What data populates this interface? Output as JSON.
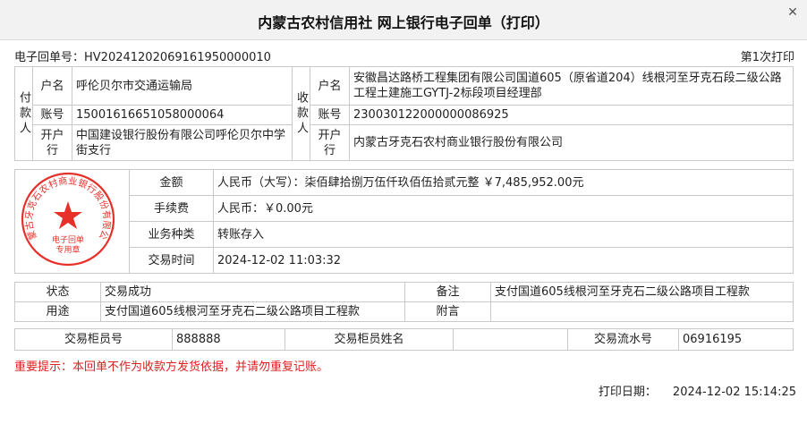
{
  "window": {
    "title": "内蒙古农村信用社 网上银行电子回单（打印）"
  },
  "header": {
    "receipt_no_label": "电子回单号：",
    "receipt_no": "HV20241202069161950000010",
    "print_count": "第1次打印"
  },
  "payer": {
    "side_label": "付款人",
    "name_label": "户名",
    "name": "呼伦贝尔市交通运输局",
    "account_label": "账号",
    "account": "15001616651058000064",
    "bank_label": "开户行",
    "bank": "中国建设银行股份有限公司呼伦贝尔中学街支行"
  },
  "payee": {
    "side_label": "收款人",
    "name_label": "户名",
    "name": "安徽昌达路桥工程集团有限公司国道605（原省道204）线根河至牙克石段二级公路工程土建施工GYTJ-2标段项目经理部",
    "account_label": "账号",
    "account": "230030122000000086925",
    "bank_label": "开户行",
    "bank": "内蒙古牙克石农村商业银行股份有限公司"
  },
  "amount": {
    "amount_label": "金额",
    "amount_value": "人民币（大写）：柒佰肆拾捌万伍仟玖佰伍拾贰元整  ￥7,485,952.00元",
    "fee_label": "手续费",
    "fee_value": "人民币：￥0.00元",
    "type_label": "业务种类",
    "type_value": "转账存入",
    "time_label": "交易时间",
    "time_value": "2024-12-02 11:03:32"
  },
  "stamp": {
    "text": "内蒙古牙克石农村商业银行股份有限公司",
    "inner": "电子回单专用章",
    "color": "#e8302a"
  },
  "status": {
    "status_label": "状态",
    "status_value": "交易成功",
    "remark_label": "备注",
    "remark_value": "支付国道605线根河至牙克石二级公路项目工程款",
    "purpose_label": "用途",
    "purpose_value": "支付国道605线根河至牙克石二级公路项目工程款",
    "postscript_label": "附言",
    "postscript_value": ""
  },
  "teller": {
    "no_label": "交易柜员号",
    "no_value": "888888",
    "name_label": "交易柜员姓名",
    "name_value": "",
    "serial_label": "交易流水号",
    "serial_value": "06916195"
  },
  "notice": "重要提示：本回单不作为收款方发货依据，并请勿重复记账。",
  "print_date": {
    "label": "打印日期：",
    "value": "2024-12-02 15:14:25"
  }
}
